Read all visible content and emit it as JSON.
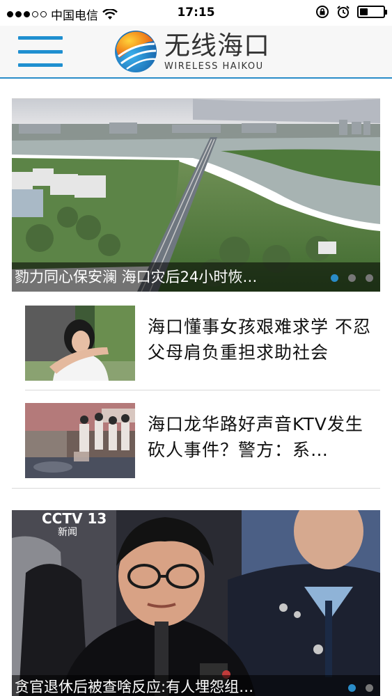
{
  "status_bar": {
    "carrier": "中国电信",
    "time": "17:15",
    "battery_level": 0.35
  },
  "header": {
    "logo_cn": "无线海口",
    "logo_en": "WIRELESS HAIKOU",
    "accent_color": "#2a8cc8"
  },
  "feed": {
    "hero_top": {
      "caption": "勠力同心保安澜 海口灾后24小时恢…",
      "slide_count": 3,
      "active_slide": 1
    },
    "items": [
      {
        "title": "海口懂事女孩艰难求学 不忍父母肩负重担求助社会"
      },
      {
        "title": "海口龙华路好声音KTV发生砍人事件？警方：系…"
      }
    ],
    "hero_bottom": {
      "watermark": "CCTV 13",
      "watermark_sub": "新闻",
      "caption": "贪官退休后被查啥反应:有人埋怨组…",
      "slide_count": 2,
      "active_slide": 1
    }
  }
}
